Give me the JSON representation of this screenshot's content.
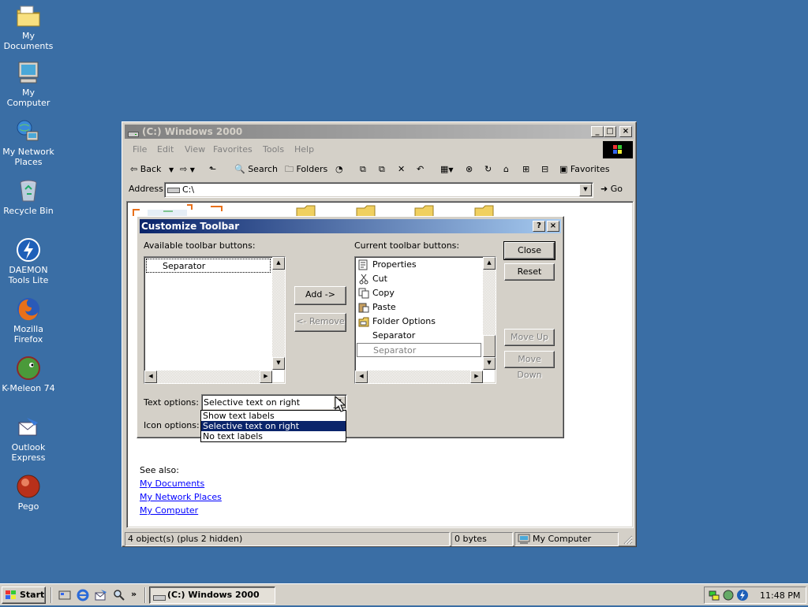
{
  "desktop": {
    "icons": [
      {
        "label": "My Documents",
        "icon": "folder-documents-icon"
      },
      {
        "label": "My Computer",
        "icon": "computer-icon"
      },
      {
        "label": "My Network Places",
        "icon": "network-icon"
      },
      {
        "label": "Recycle Bin",
        "icon": "recycle-bin-icon"
      },
      {
        "label": "DAEMON Tools Lite",
        "icon": "daemon-tools-icon"
      },
      {
        "label": "Mozilla Firefox",
        "icon": "firefox-icon"
      },
      {
        "label": "K-Meleon 74",
        "icon": "kmeleon-icon"
      },
      {
        "label": "Outlook Express",
        "icon": "outlook-express-icon"
      },
      {
        "label": "Pego",
        "icon": "pego-icon"
      }
    ]
  },
  "explorer": {
    "title": "(C:) Windows 2000",
    "menu": [
      "File",
      "Edit",
      "View",
      "Favorites",
      "Tools",
      "Help"
    ],
    "toolbar": {
      "back": "Back",
      "search": "Search",
      "folders": "Folders",
      "favorites": "Favorites"
    },
    "address": {
      "label": "Address",
      "value": "C:\\",
      "go": "Go"
    },
    "see_also": {
      "title": "See also:",
      "links": [
        "My Documents",
        "My Network Places",
        "My Computer"
      ]
    },
    "status": {
      "objects": "4 object(s) (plus 2 hidden)",
      "size": "0 bytes",
      "zone": "My Computer"
    }
  },
  "dialog": {
    "title": "Customize Toolbar",
    "available_label": "Available toolbar buttons:",
    "available_items": [
      "Separator"
    ],
    "current_label": "Current toolbar buttons:",
    "current_items": [
      {
        "label": "Properties",
        "icon": "properties-icon"
      },
      {
        "label": "Cut",
        "icon": "cut-icon"
      },
      {
        "label": "Copy",
        "icon": "copy-icon"
      },
      {
        "label": "Paste",
        "icon": "paste-icon"
      },
      {
        "label": "Folder Options",
        "icon": "folder-options-icon"
      },
      {
        "label": "Separator",
        "icon": ""
      },
      {
        "label": "Separator",
        "icon": ""
      }
    ],
    "buttons": {
      "add": "Add ->",
      "remove": "<- Remove",
      "close": "Close",
      "reset": "Reset",
      "move_up": "Move Up",
      "move_down": "Move Down"
    },
    "text_options": {
      "label": "Text options:",
      "value": "Selective text on right",
      "options": [
        "Show text labels",
        "Selective text on right",
        "No text labels"
      ],
      "selected_index": 1
    },
    "icon_options": {
      "label": "Icon options:"
    }
  },
  "taskbar": {
    "start": "Start",
    "task": "(C:) Windows 2000",
    "clock": "11:48 PM"
  },
  "colors": {
    "desktop": "#3a6ea5",
    "titlebar_active": "#0a246a",
    "face": "#d4d0c8",
    "link": "#0000ff"
  }
}
